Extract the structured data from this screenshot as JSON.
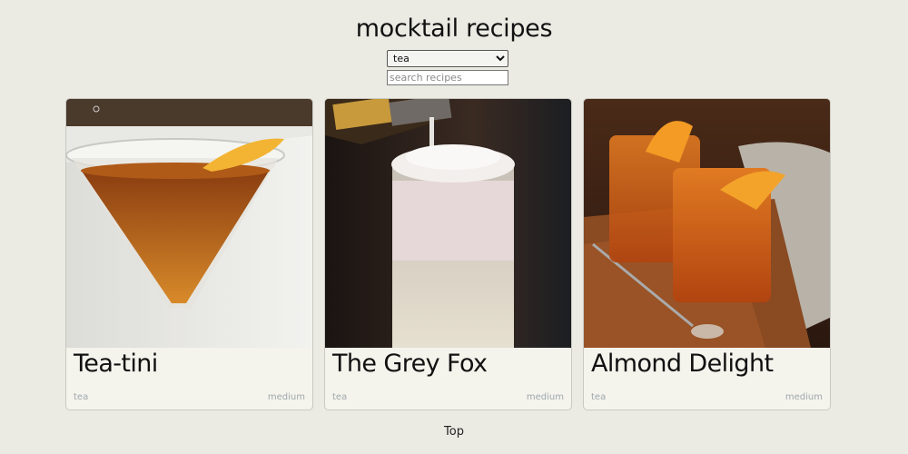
{
  "header": {
    "title": "mocktail recipes"
  },
  "filter": {
    "selected": "tea",
    "options": [
      "tea"
    ]
  },
  "search": {
    "placeholder": "search recipes",
    "value": ""
  },
  "recipes": [
    {
      "name": "Tea-tini",
      "category": "tea",
      "difficulty": "medium",
      "image": "martini-glass-amber-drink-image"
    },
    {
      "name": "The Grey Fox",
      "category": "tea",
      "difficulty": "medium",
      "image": "frothy-tall-glass-drink-image"
    },
    {
      "name": "Almond Delight",
      "category": "tea",
      "difficulty": "medium",
      "image": "two-orange-tumblers-drink-image"
    }
  ],
  "footer": {
    "top_link": "Top"
  },
  "colors": {
    "background": "#ebebe4",
    "card_background": "#f4f3ec",
    "tag_text": "#9fa8ad"
  }
}
